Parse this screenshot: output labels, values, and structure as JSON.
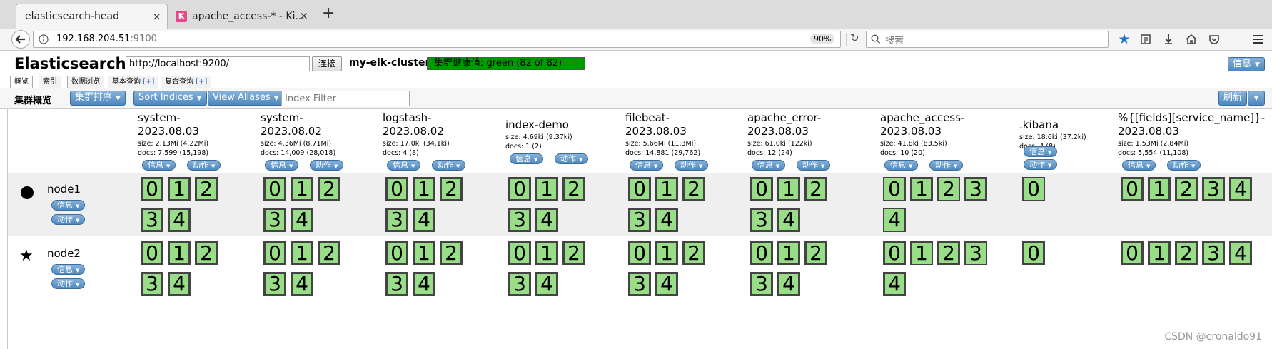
{
  "browser": {
    "tabs": [
      {
        "label": "elasticsearch-head",
        "active": true
      },
      {
        "label": "apache_access-* - Ki...",
        "active": false
      }
    ],
    "new_tab": "+",
    "close": "×",
    "url_host": "192.168.204.51",
    "url_port": ":9100",
    "zoom": "90%",
    "search_placeholder": "搜索"
  },
  "head": {
    "title": "Elasticsearch",
    "connect_url": "http://localhost:9200/",
    "connect_label": "连接",
    "cluster_name": "my-elk-cluster",
    "health_text": "集群健康值: green (82 of 82)",
    "info_label": "信息",
    "tabs": [
      {
        "label": "概览"
      },
      {
        "label": "索引"
      },
      {
        "label": "数据浏览"
      },
      {
        "label": "基本查询",
        "plus": "[+]"
      },
      {
        "label": "复合查询",
        "plus": "[+]"
      }
    ],
    "toolbar": {
      "overview": "集群概览",
      "sort_cluster": "集群排序",
      "sort_indices": "Sort Indices",
      "view_aliases": "View Aliases",
      "index_filter_placeholder": "Index Filter",
      "refresh": "刷新"
    },
    "colors": {
      "health_green": "#009900",
      "shard_green": "#99dd88",
      "button_blue": "#5b93c6"
    }
  },
  "pill_labels": {
    "info": "信息",
    "action": "动作"
  },
  "indices": [
    {
      "name": "system-\n2023.08.03",
      "size": "size: 2.13Mi (4.22Mi)",
      "docs": "docs: 7,599 (15,198)",
      "shards": [
        0,
        1,
        2,
        3,
        4
      ]
    },
    {
      "name": "system-\n2023.08.02",
      "size": "size: 4.36Mi (8.71Mi)",
      "docs": "docs: 14,009 (28,018)",
      "shards": [
        0,
        1,
        2,
        3,
        4
      ]
    },
    {
      "name": "logstash-\n2023.08.02",
      "size": "size: 17.0ki (34.1ki)",
      "docs": "docs: 4 (8)",
      "shards": [
        0,
        1,
        2,
        3,
        4
      ]
    },
    {
      "name": "index-demo",
      "size": "size: 4.69ki (9.37ki)",
      "docs": "docs: 1 (2)",
      "shards": [
        0,
        1,
        2,
        3,
        4
      ]
    },
    {
      "name": "filebeat-\n2023.08.03",
      "size": "size: 5.66Mi (11.3Mi)",
      "docs": "docs: 14,881 (29,762)",
      "shards": [
        0,
        1,
        2,
        3,
        4
      ]
    },
    {
      "name": "apache_error-\n2023.08.03",
      "size": "size: 61.0ki (122ki)",
      "docs": "docs: 12 (24)",
      "shards": [
        0,
        1,
        2,
        3,
        4
      ]
    },
    {
      "name": "apache_access-\n2023.08.03",
      "size": "size: 41.8ki (83.5ki)",
      "docs": "docs: 10 (20)",
      "shards": [
        0,
        1,
        2,
        3,
        4
      ]
    },
    {
      "name": ".kibana",
      "size": "size: 18.6ki (37.2ki)",
      "docs": "docs: 4 (8)",
      "shards": [
        0
      ]
    },
    {
      "name": "%{[fields][service_name]}-\n2023.08.03",
      "size": "size: 1.53Mi (2.84Mi)",
      "docs": "docs: 5,554 (11,108)",
      "shards": [
        0,
        1,
        2,
        3,
        4
      ]
    }
  ],
  "nodes": [
    {
      "name": "node1",
      "icon": "circle"
    },
    {
      "name": "node2",
      "icon": "star"
    }
  ],
  "watermark": "CSDN @cronaldo91"
}
